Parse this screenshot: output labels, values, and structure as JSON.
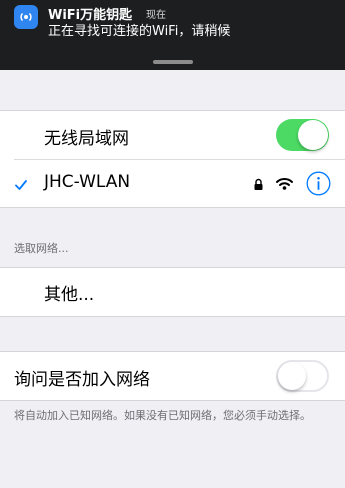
{
  "notification": {
    "app_name": "WiFi万能钥匙",
    "time": "现在",
    "message": "正在寻找可连接的WiFi，请稍候",
    "icon": "wifi-key-app-icon"
  },
  "wlan": {
    "label": "无线局域网",
    "enabled": true
  },
  "current_network": {
    "name": "JHC-WLAN",
    "connected": true,
    "secured": true,
    "icons": [
      "checkmark-icon",
      "lock-icon",
      "wifi-signal-icon",
      "info-icon"
    ]
  },
  "choose_network": {
    "header": "选取网络...",
    "other_label": "其他..."
  },
  "ask_to_join": {
    "label": "询问是否加入网络",
    "enabled": false,
    "footer": "将自动加入已知网络。如果没有已知网络，您必须手动选择。"
  },
  "colors": {
    "accent": "#007aff",
    "toggle_on": "#4cd964",
    "background": "#efeff4"
  }
}
